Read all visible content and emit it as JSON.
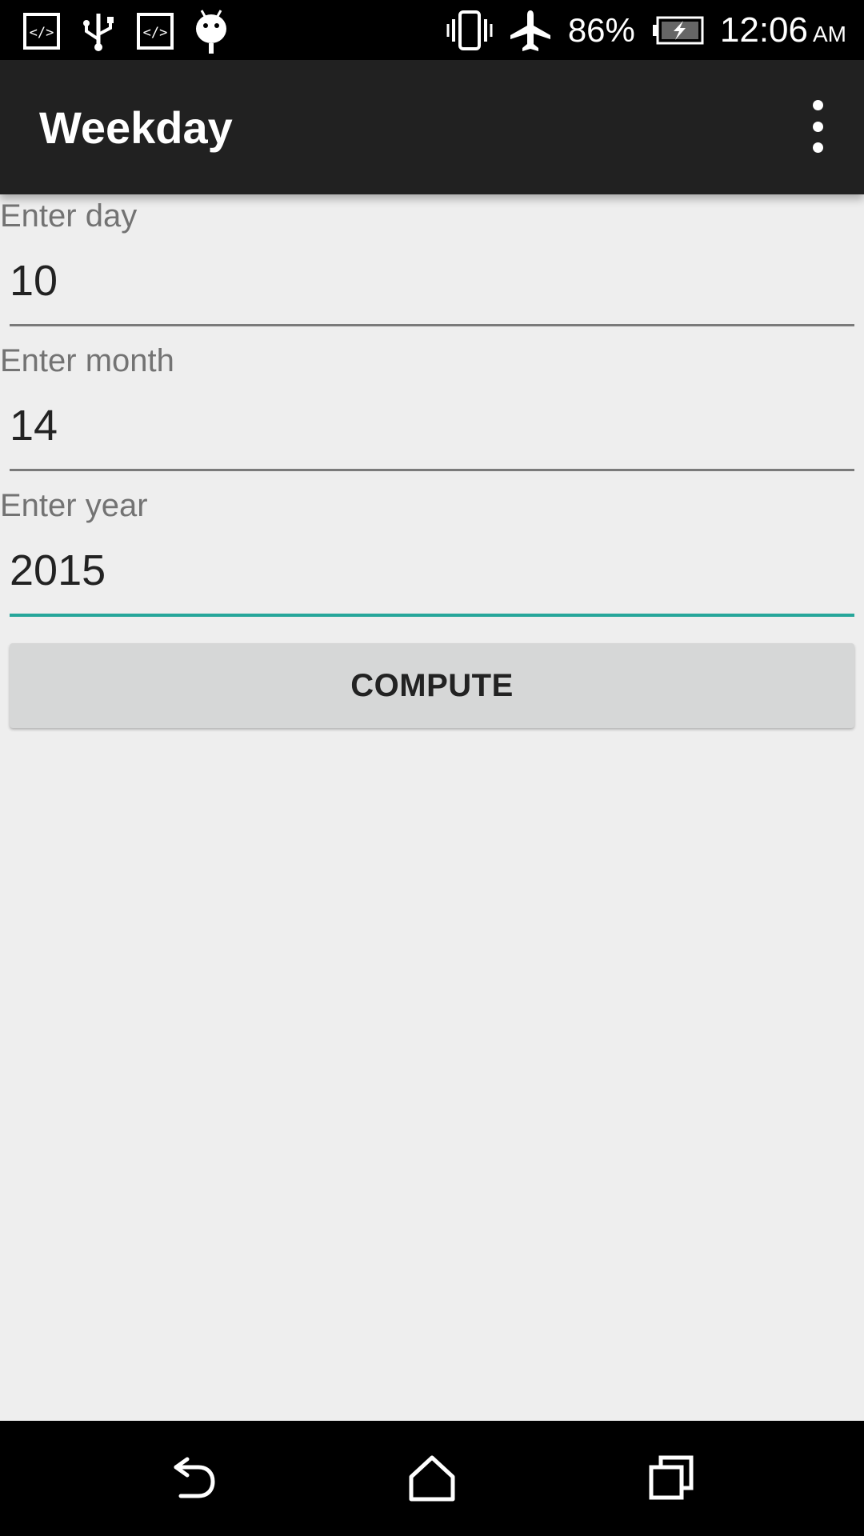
{
  "status_bar": {
    "icons_left": [
      "code-icon",
      "usb-icon",
      "code-icon",
      "android-debug-icon"
    ],
    "icons_right": [
      "vibrate-icon",
      "airplane-mode-icon",
      "battery-charging-icon"
    ],
    "battery_percent": "86%",
    "time": "12:06",
    "ampm": "AM"
  },
  "app_bar": {
    "title": "Weekday",
    "menu_icon": "overflow-menu-icon"
  },
  "form": {
    "day": {
      "label": "Enter day",
      "value": "10"
    },
    "month": {
      "label": "Enter month",
      "value": "14"
    },
    "year": {
      "label": "Enter year",
      "value": "2015"
    },
    "compute_label": "COMPUTE"
  },
  "nav_bar": {
    "icons": [
      "back-icon",
      "home-icon",
      "recents-icon"
    ]
  },
  "colors": {
    "app_bar": "#212121",
    "background": "#eeeeee",
    "accent": "#26a69a",
    "button": "#d6d7d7"
  }
}
